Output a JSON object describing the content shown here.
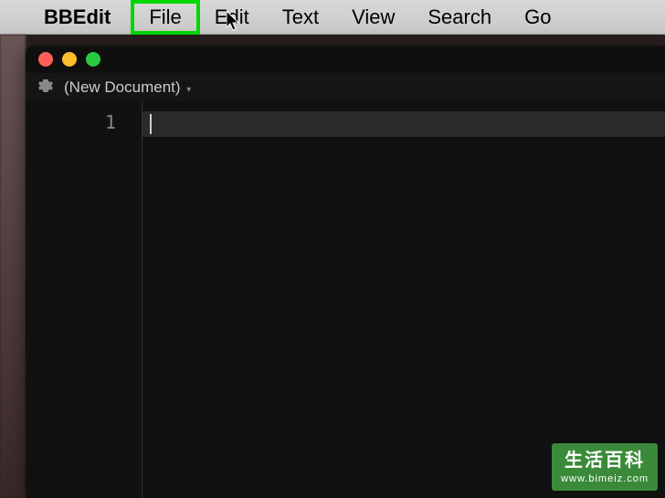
{
  "menubar": {
    "app_name": "BBEdit",
    "items": [
      "File",
      "Edit",
      "Text",
      "View",
      "Search",
      "Go"
    ],
    "highlighted_index": 0
  },
  "window": {
    "document_title": "(New Document)",
    "line_numbers": [
      "1"
    ]
  },
  "watermark": {
    "title": "生活百科",
    "url": "www.bimeiz.com"
  }
}
